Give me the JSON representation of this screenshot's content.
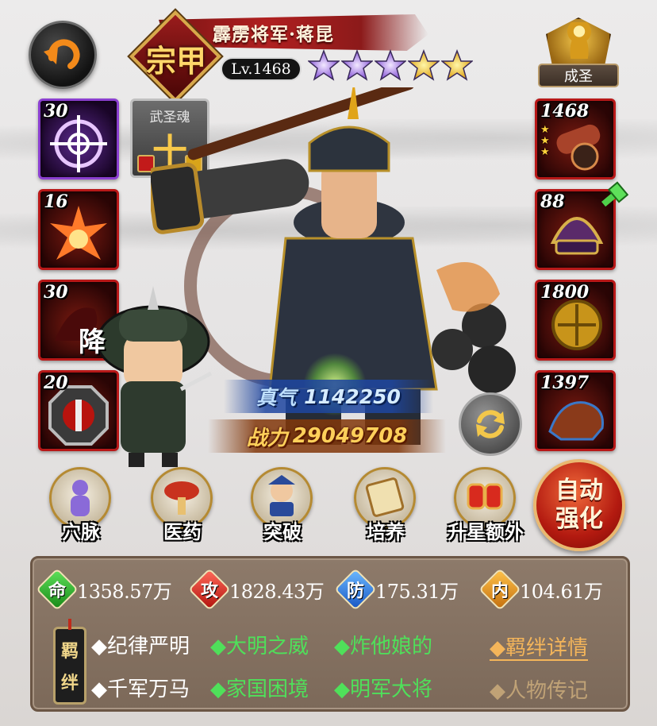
{
  "hero": {
    "name": "霹雳将军·蒋昆",
    "rank_glyph": "宗甲",
    "level": "Lv.1468",
    "stars": [
      "purple",
      "purple",
      "purple",
      "gold",
      "gold"
    ],
    "title_badge": "成圣"
  },
  "soul": {
    "title": "武圣魂",
    "value": "十"
  },
  "left_slots": [
    {
      "level": "30",
      "color": "purple",
      "icon": "crosshair-icon"
    },
    {
      "level": "16",
      "color": "red",
      "icon": "explosion-icon"
    },
    {
      "level": "30",
      "color": "red",
      "icon": "surrender-icon",
      "text": "降"
    },
    {
      "level": "20",
      "color": "red",
      "icon": "axe-seal-icon"
    }
  ],
  "right_slots": [
    {
      "level": "1468",
      "color": "red",
      "icon": "cannon-icon"
    },
    {
      "level": "88",
      "color": "red",
      "icon": "helmet-icon"
    },
    {
      "level": "1800",
      "color": "red",
      "icon": "armor-icon"
    },
    {
      "level": "1397",
      "color": "red",
      "icon": "mount-icon"
    }
  ],
  "stats_center": {
    "vigor_label": "真气",
    "vigor_value": "1142250",
    "power_label": "战力",
    "power_value": "29049708"
  },
  "actions": [
    {
      "label": "穴脉",
      "icon": "meridian-icon"
    },
    {
      "label": "医药",
      "icon": "medicine-icon"
    },
    {
      "label": "突破",
      "icon": "breakthrough-icon"
    },
    {
      "label": "培养",
      "icon": "scroll-icon"
    },
    {
      "label": "升星额外",
      "icon": "gloves-icon"
    }
  ],
  "auto_enhance": {
    "line1": "自动",
    "line2": "强化"
  },
  "attributes": [
    {
      "glyph": "命",
      "value": "1358.57万",
      "color": "#2fb02a"
    },
    {
      "glyph": "攻",
      "value": "1828.43万",
      "color": "#d8281e"
    },
    {
      "glyph": "防",
      "value": "175.31万",
      "color": "#2a7ae0"
    },
    {
      "glyph": "内",
      "value": "104.61万",
      "color": "#e08a1a"
    }
  ],
  "bonds": {
    "tag": [
      "羁",
      "绊"
    ],
    "row1": [
      {
        "text": "◆纪律严明",
        "state": "inactive"
      },
      {
        "text": "◆大明之威",
        "state": "active"
      },
      {
        "text": "◆炸他娘的",
        "state": "active"
      }
    ],
    "row2": [
      {
        "text": "◆千军万马",
        "state": "inactive"
      },
      {
        "text": "◆家国困境",
        "state": "active"
      },
      {
        "text": "◆明军大将",
        "state": "active"
      }
    ],
    "details_link": "◆羁绊详情",
    "biography_link": "◆人物传记"
  }
}
